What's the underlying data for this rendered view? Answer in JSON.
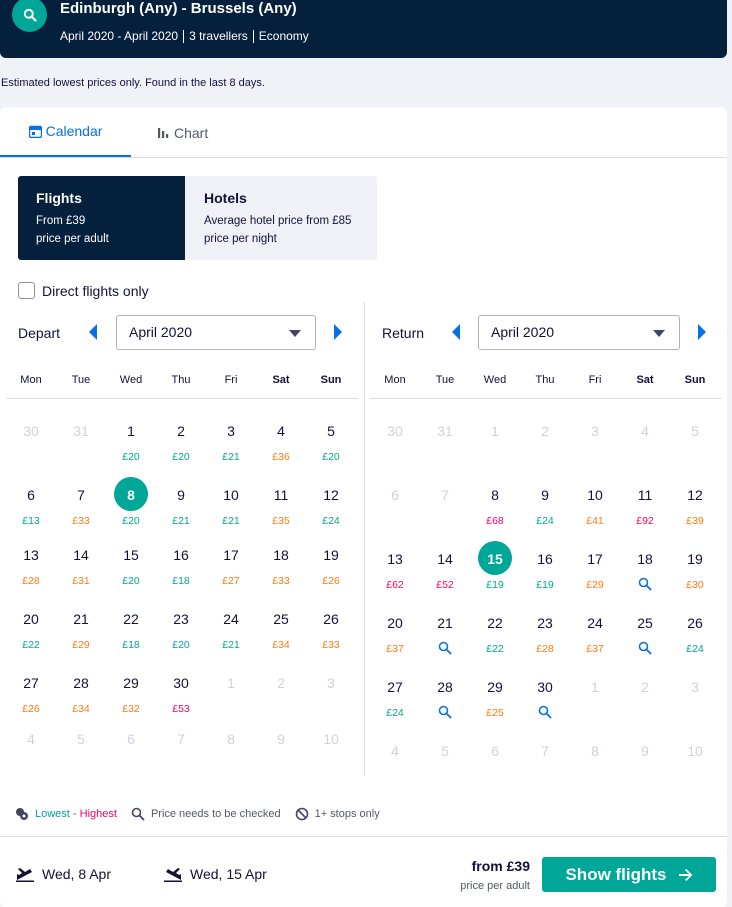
{
  "header": {
    "route": "Edinburgh (Any) - Brussels (Any)",
    "dates": "April 2020 - April 2020",
    "travellers": "3 travellers",
    "cabin": "Economy"
  },
  "note": "Estimated lowest prices only. Found in the last 8 days.",
  "tabs": [
    {
      "label": "Calendar",
      "icon": "calendar-icon"
    },
    {
      "label": "Chart",
      "icon": "bar-chart-icon"
    }
  ],
  "cards": {
    "flights": {
      "title": "Flights",
      "line1": "From £39",
      "line2": "price per adult"
    },
    "hotels": {
      "title": "Hotels",
      "line1": "Average hotel price from £85",
      "line2": "price per night"
    }
  },
  "direct_label": "Direct flights only",
  "weekdays": [
    "Mon",
    "Tue",
    "Wed",
    "Thu",
    "Fri",
    "Sat",
    "Sun"
  ],
  "depart": {
    "label": "Depart",
    "month": "April 2020",
    "selected_day": 8,
    "days": [
      {
        "d": "30",
        "m": true
      },
      {
        "d": "31",
        "m": true
      },
      {
        "d": "1",
        "p": "£20",
        "c": "low"
      },
      {
        "d": "2",
        "p": "£20",
        "c": "low"
      },
      {
        "d": "3",
        "p": "£21",
        "c": "low"
      },
      {
        "d": "4",
        "p": "£36",
        "c": "mid"
      },
      {
        "d": "5",
        "p": "£20",
        "c": "low"
      },
      {
        "d": "6",
        "p": "£13",
        "c": "low"
      },
      {
        "d": "7",
        "p": "£33",
        "c": "mid"
      },
      {
        "d": "8",
        "p": "£20",
        "c": "low",
        "sel": true
      },
      {
        "d": "9",
        "p": "£21",
        "c": "low"
      },
      {
        "d": "10",
        "p": "£21",
        "c": "low"
      },
      {
        "d": "11",
        "p": "£35",
        "c": "mid"
      },
      {
        "d": "12",
        "p": "£24",
        "c": "low"
      },
      {
        "d": "13",
        "p": "£28",
        "c": "mid"
      },
      {
        "d": "14",
        "p": "£31",
        "c": "mid"
      },
      {
        "d": "15",
        "p": "£20",
        "c": "low"
      },
      {
        "d": "16",
        "p": "£18",
        "c": "low"
      },
      {
        "d": "17",
        "p": "£27",
        "c": "mid"
      },
      {
        "d": "18",
        "p": "£33",
        "c": "mid"
      },
      {
        "d": "19",
        "p": "£26",
        "c": "mid"
      },
      {
        "d": "20",
        "p": "£22",
        "c": "low"
      },
      {
        "d": "21",
        "p": "£29",
        "c": "mid"
      },
      {
        "d": "22",
        "p": "£18",
        "c": "low"
      },
      {
        "d": "23",
        "p": "£20",
        "c": "low"
      },
      {
        "d": "24",
        "p": "£21",
        "c": "low"
      },
      {
        "d": "25",
        "p": "£34",
        "c": "mid"
      },
      {
        "d": "26",
        "p": "£33",
        "c": "mid"
      },
      {
        "d": "27",
        "p": "£26",
        "c": "mid"
      },
      {
        "d": "28",
        "p": "£34",
        "c": "mid"
      },
      {
        "d": "29",
        "p": "£32",
        "c": "mid"
      },
      {
        "d": "30",
        "p": "£53",
        "c": "high"
      },
      {
        "d": "1",
        "m": true
      },
      {
        "d": "2",
        "m": true
      },
      {
        "d": "3",
        "m": true
      },
      {
        "d": "4",
        "m": true
      },
      {
        "d": "5",
        "m": true
      },
      {
        "d": "6",
        "m": true
      },
      {
        "d": "7",
        "m": true
      },
      {
        "d": "8",
        "m": true
      },
      {
        "d": "9",
        "m": true
      },
      {
        "d": "10",
        "m": true
      }
    ]
  },
  "return": {
    "label": "Return",
    "month": "April 2020",
    "selected_day": 15,
    "days": [
      {
        "d": "30",
        "m": true
      },
      {
        "d": "31",
        "m": true
      },
      {
        "d": "1",
        "m": true
      },
      {
        "d": "2",
        "m": true
      },
      {
        "d": "3",
        "m": true
      },
      {
        "d": "4",
        "m": true
      },
      {
        "d": "5",
        "m": true
      },
      {
        "d": "6",
        "m": true
      },
      {
        "d": "7",
        "m": true
      },
      {
        "d": "8",
        "p": "£68",
        "c": "high"
      },
      {
        "d": "9",
        "p": "£24",
        "c": "low"
      },
      {
        "d": "10",
        "p": "£41",
        "c": "mid"
      },
      {
        "d": "11",
        "p": "£92",
        "c": "high"
      },
      {
        "d": "12",
        "p": "£39",
        "c": "mid"
      },
      {
        "d": "13",
        "p": "£62",
        "c": "high"
      },
      {
        "d": "14",
        "p": "£52",
        "c": "high"
      },
      {
        "d": "15",
        "p": "£19",
        "c": "low",
        "sel": true
      },
      {
        "d": "16",
        "p": "£19",
        "c": "low"
      },
      {
        "d": "17",
        "p": "£29",
        "c": "mid"
      },
      {
        "d": "18",
        "q": true
      },
      {
        "d": "19",
        "p": "£30",
        "c": "mid"
      },
      {
        "d": "20",
        "p": "£37",
        "c": "mid"
      },
      {
        "d": "21",
        "q": true
      },
      {
        "d": "22",
        "p": "£22",
        "c": "low"
      },
      {
        "d": "23",
        "p": "£28",
        "c": "mid"
      },
      {
        "d": "24",
        "p": "£37",
        "c": "mid"
      },
      {
        "d": "25",
        "q": true
      },
      {
        "d": "26",
        "p": "£24",
        "c": "low"
      },
      {
        "d": "27",
        "p": "£24",
        "c": "low"
      },
      {
        "d": "28",
        "q": true
      },
      {
        "d": "29",
        "p": "£25",
        "c": "mid"
      },
      {
        "d": "30",
        "q": true
      },
      {
        "d": "1",
        "m": true
      },
      {
        "d": "2",
        "m": true
      },
      {
        "d": "3",
        "m": true
      },
      {
        "d": "4",
        "m": true
      },
      {
        "d": "5",
        "m": true
      },
      {
        "d": "6",
        "m": true
      },
      {
        "d": "7",
        "m": true
      },
      {
        "d": "8",
        "m": true
      },
      {
        "d": "9",
        "m": true
      },
      {
        "d": "10",
        "m": true
      }
    ]
  },
  "legend": {
    "lowest": "Lowest",
    "dash": " - ",
    "highest": "Highest",
    "check": "Price needs to be checked",
    "stops": "1+ stops only"
  },
  "footer": {
    "out_date": "Wed, 8 Apr",
    "ret_date": "Wed, 15 Apr",
    "from_price": "from £39",
    "per_adult": "price per adult",
    "show_label": "Show flights"
  },
  "colors": {
    "low": "#00a698",
    "mid": "#ff7b0f",
    "high": "#e70866",
    "accent": "#0770e3",
    "navy": "#05203c"
  }
}
